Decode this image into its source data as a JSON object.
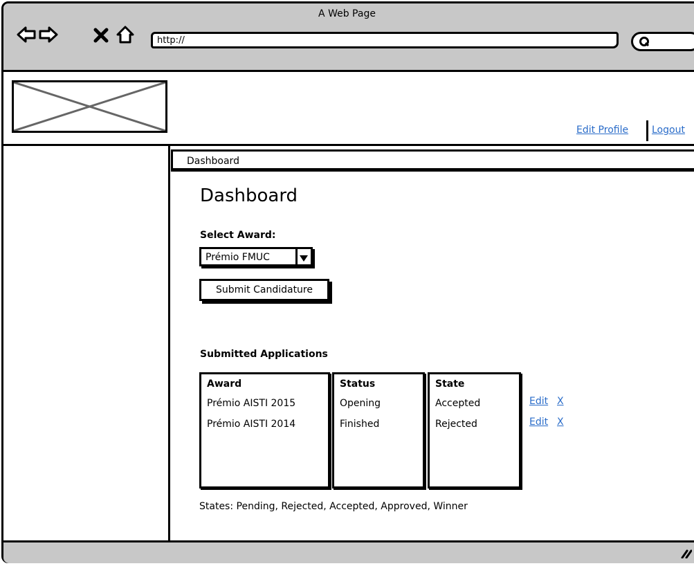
{
  "window": {
    "title": "A Web Page"
  },
  "browser": {
    "url": "http://"
  },
  "header": {
    "links": {
      "edit_profile": "Edit Profile",
      "logout": "Logout"
    }
  },
  "breadcrumb": {
    "label": "Dashboard"
  },
  "main": {
    "title": "Dashboard",
    "select_award": {
      "label": "Select Award:",
      "selected": "Prémio FMUC"
    },
    "submit_button": "Submit Candidature",
    "applications": {
      "title": "Submitted Applications",
      "columns": [
        "Award",
        "Status",
        "State"
      ],
      "rows": [
        {
          "award": "Prémio AISTI 2015",
          "status": "Opening",
          "state": "Accepted",
          "edit": "Edit",
          "delete": "X"
        },
        {
          "award": "Prémio AISTI 2014",
          "status": "Finished",
          "state": "Rejected",
          "edit": "Edit",
          "delete": "X"
        }
      ]
    },
    "states_note": "States: Pending, Rejected, Accepted, Approved, Winner"
  },
  "colors": {
    "link": "#2a6cc9",
    "chrome": "#c8c8c8"
  }
}
